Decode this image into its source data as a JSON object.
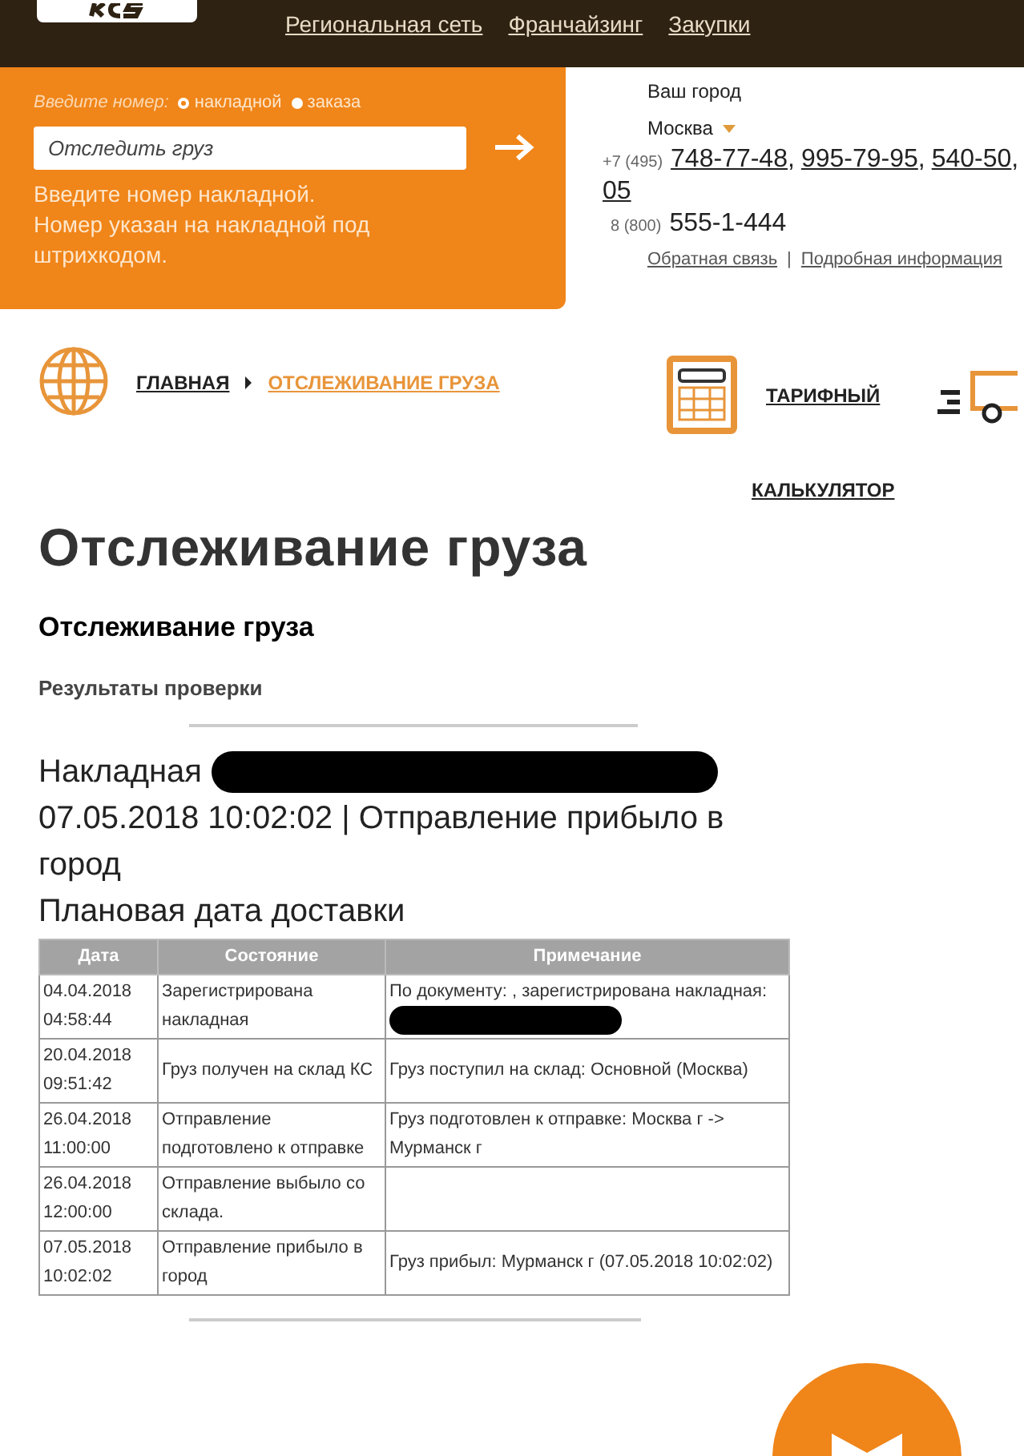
{
  "header": {
    "nav_links": [
      "Региональная сеть",
      "Франчайзинг",
      "Закупки"
    ]
  },
  "tracking_form": {
    "prompt": "Введите номер:",
    "options": [
      {
        "label": "накладной",
        "selected": true
      },
      {
        "label": "заказа",
        "selected": false
      }
    ],
    "placeholder": "Отследить груз",
    "hint": "Введите номер накладной.\nНомер указан на накладной под штрихкодом."
  },
  "city": {
    "label": "Ваш город",
    "value": "Москва"
  },
  "phones": [
    {
      "prefix": "+7 (495)",
      "separator": ",",
      "numbers": [
        "748-77-48",
        "995-79-95",
        "540-50",
        "05"
      ]
    },
    {
      "prefix": "8 (800)",
      "numbers": [
        "555-1-444"
      ]
    }
  ],
  "info_links": [
    "Обратная связь",
    "Подробная информация"
  ],
  "info_separator": "|",
  "breadcrumbs": [
    {
      "label": "ГЛАВНАЯ",
      "selected": false
    },
    {
      "label": "ОТСЛЕЖИВАНИЕ ГРУЗА",
      "selected": true
    }
  ],
  "calculator": {
    "line1": "ТАРИФНЫЙ",
    "line2": "КАЛЬКУЛЯТОР"
  },
  "title": "Отслеживание груза",
  "subtitle": "Отслеживание груза",
  "section": "Результаты проверки",
  "summary": {
    "waybill_label": "Накладная",
    "status": "07.05.2018 10:02:02 | Отправление прибыло в город",
    "planned": "Плановая дата доставки"
  },
  "table": {
    "columns": [
      "Дата",
      "Состояние",
      "Примечание"
    ],
    "rows": [
      {
        "date": "04.04.2018 04:58:44",
        "state": "Зарегистрирована накладная",
        "note": "По документу: , зарегистрирована накладная:",
        "redacted": true
      },
      {
        "date": "20.04.2018 09:51:42",
        "state": "Груз получен на склад КС",
        "note": "Груз поступил на склад: Основной (Москва)",
        "redacted": false
      },
      {
        "date": "26.04.2018 11:00:00",
        "state": "Отправление подготовлено к отправке",
        "note": "Груз подготовлен к отправке: Москва г -> Мурманск г",
        "redacted": false
      },
      {
        "date": "26.04.2018 12:00:00",
        "state": "Отправление выбыло со склада.",
        "note": "",
        "redacted": false
      },
      {
        "date": "07.05.2018 10:02:02",
        "state": "Отправление прибыло в город",
        "note": "Груз прибыл: Мурманск г (07.05.2018 10:02:02)",
        "redacted": false
      }
    ]
  }
}
